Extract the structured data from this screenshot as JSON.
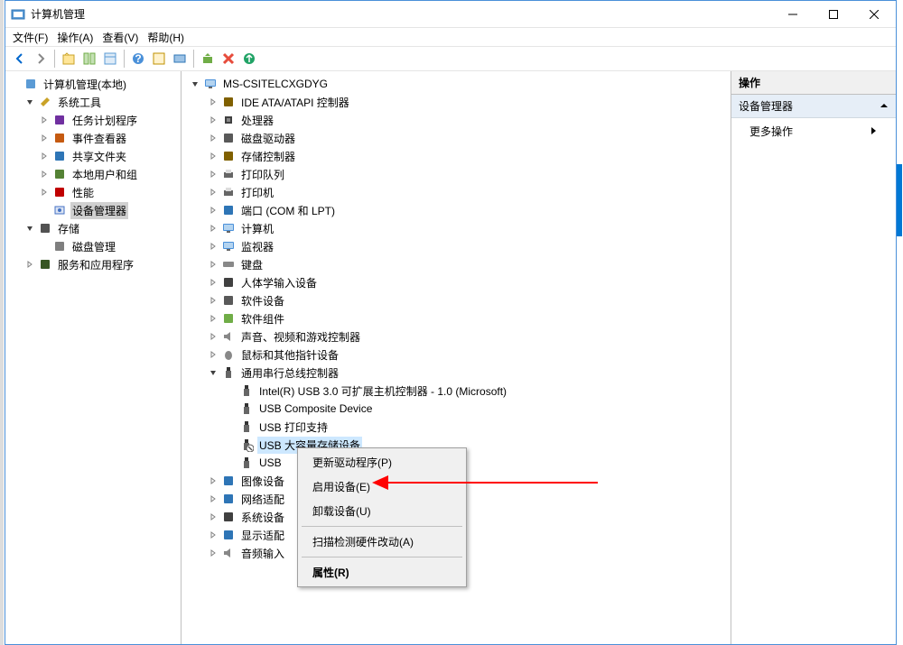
{
  "window": {
    "title": "计算机管理"
  },
  "menubar": [
    "文件(F)",
    "操作(A)",
    "查看(V)",
    "帮助(H)"
  ],
  "win_controls": {
    "min": "min",
    "max": "max",
    "close": "close"
  },
  "left_tree": [
    {
      "indent": 0,
      "chevron": "",
      "icon": "mgmt",
      "label": "计算机管理(本地)"
    },
    {
      "indent": 1,
      "chevron": "down",
      "icon": "tools",
      "label": "系统工具"
    },
    {
      "indent": 2,
      "chevron": "right",
      "icon": "task",
      "label": "任务计划程序"
    },
    {
      "indent": 2,
      "chevron": "right",
      "icon": "event",
      "label": "事件查看器"
    },
    {
      "indent": 2,
      "chevron": "right",
      "icon": "share",
      "label": "共享文件夹"
    },
    {
      "indent": 2,
      "chevron": "right",
      "icon": "users",
      "label": "本地用户和组"
    },
    {
      "indent": 2,
      "chevron": "right",
      "icon": "perf",
      "label": "性能"
    },
    {
      "indent": 2,
      "chevron": "",
      "icon": "devmgr",
      "label": "设备管理器",
      "selected": true
    },
    {
      "indent": 1,
      "chevron": "down",
      "icon": "storage",
      "label": "存储"
    },
    {
      "indent": 2,
      "chevron": "",
      "icon": "disk",
      "label": "磁盘管理"
    },
    {
      "indent": 1,
      "chevron": "right",
      "icon": "svc",
      "label": "服务和应用程序"
    }
  ],
  "mid_tree": [
    {
      "indent": 0,
      "chevron": "down",
      "icon": "pc",
      "label": "MS-CSITELCXGDYG"
    },
    {
      "indent": 1,
      "chevron": "right",
      "icon": "ide",
      "label": "IDE ATA/ATAPI 控制器"
    },
    {
      "indent": 1,
      "chevron": "right",
      "icon": "cpu",
      "label": "处理器"
    },
    {
      "indent": 1,
      "chevron": "right",
      "icon": "diskdrv",
      "label": "磁盘驱动器"
    },
    {
      "indent": 1,
      "chevron": "right",
      "icon": "storctl",
      "label": "存储控制器"
    },
    {
      "indent": 1,
      "chevron": "right",
      "icon": "printq",
      "label": "打印队列"
    },
    {
      "indent": 1,
      "chevron": "right",
      "icon": "printer",
      "label": "打印机"
    },
    {
      "indent": 1,
      "chevron": "right",
      "icon": "port",
      "label": "端口 (COM 和 LPT)"
    },
    {
      "indent": 1,
      "chevron": "right",
      "icon": "computer",
      "label": "计算机"
    },
    {
      "indent": 1,
      "chevron": "right",
      "icon": "monitor",
      "label": "监视器"
    },
    {
      "indent": 1,
      "chevron": "right",
      "icon": "keyboard",
      "label": "键盘"
    },
    {
      "indent": 1,
      "chevron": "right",
      "icon": "hid",
      "label": "人体学输入设备"
    },
    {
      "indent": 1,
      "chevron": "right",
      "icon": "swdev",
      "label": "软件设备"
    },
    {
      "indent": 1,
      "chevron": "right",
      "icon": "swcomp",
      "label": "软件组件"
    },
    {
      "indent": 1,
      "chevron": "right",
      "icon": "audio",
      "label": "声音、视频和游戏控制器"
    },
    {
      "indent": 1,
      "chevron": "right",
      "icon": "mouse",
      "label": "鼠标和其他指针设备"
    },
    {
      "indent": 1,
      "chevron": "down",
      "icon": "usbctl",
      "label": "通用串行总线控制器"
    },
    {
      "indent": 2,
      "chevron": "",
      "icon": "usb",
      "label": "Intel(R) USB 3.0 可扩展主机控制器 - 1.0 (Microsoft)"
    },
    {
      "indent": 2,
      "chevron": "",
      "icon": "usb",
      "label": "USB Composite Device"
    },
    {
      "indent": 2,
      "chevron": "",
      "icon": "usb",
      "label": "USB 打印支持"
    },
    {
      "indent": 2,
      "chevron": "",
      "icon": "usb-disabled",
      "label": "USB 大容量存储设备",
      "selected": true
    },
    {
      "indent": 2,
      "chevron": "",
      "icon": "usb",
      "label": "USB"
    },
    {
      "indent": 1,
      "chevron": "right",
      "icon": "image",
      "label": "图像设备"
    },
    {
      "indent": 1,
      "chevron": "right",
      "icon": "net",
      "label": "网络适配"
    },
    {
      "indent": 1,
      "chevron": "right",
      "icon": "sysdev",
      "label": "系统设备"
    },
    {
      "indent": 1,
      "chevron": "right",
      "icon": "display",
      "label": "显示适配"
    },
    {
      "indent": 1,
      "chevron": "right",
      "icon": "audioin",
      "label": "音频输入"
    }
  ],
  "right_panel": {
    "header": "操作",
    "section": "设备管理器",
    "item": "更多操作"
  },
  "context_menu": [
    {
      "type": "item",
      "label": "更新驱动程序(P)"
    },
    {
      "type": "item",
      "label": "启用设备(E)"
    },
    {
      "type": "item",
      "label": "卸载设备(U)"
    },
    {
      "type": "sep"
    },
    {
      "type": "item",
      "label": "扫描检测硬件改动(A)"
    },
    {
      "type": "sep"
    },
    {
      "type": "item",
      "label": "属性(R)",
      "bold": true
    }
  ]
}
